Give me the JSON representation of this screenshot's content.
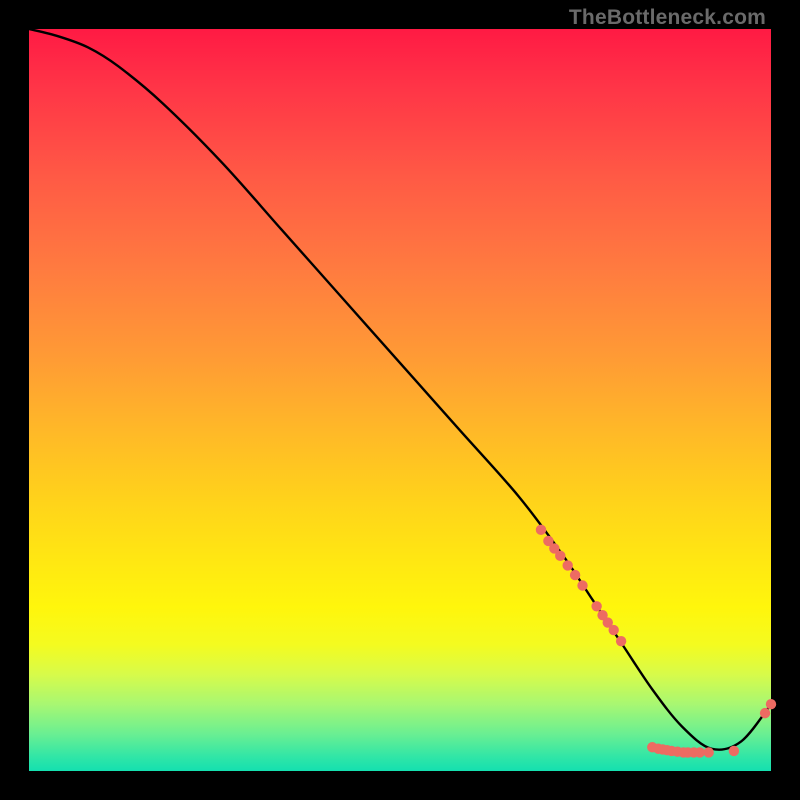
{
  "watermark": "TheBottleneck.com",
  "chart_data": {
    "type": "line",
    "title": "",
    "xlabel": "",
    "ylabel": "",
    "xlim": [
      0,
      100
    ],
    "ylim": [
      0,
      100
    ],
    "grid": false,
    "legend": "none",
    "series": [
      {
        "name": "bottleneck-curve",
        "x": [
          0,
          4,
          8,
          12,
          18,
          26,
          34,
          42,
          50,
          58,
          66,
          72,
          76,
          80,
          84,
          88,
          92,
          96,
          100
        ],
        "y": [
          100,
          99,
          97.5,
          95,
          90,
          82,
          73,
          64,
          55,
          46,
          37,
          29,
          23,
          17,
          11,
          6,
          3,
          4,
          9
        ]
      }
    ],
    "markers": [
      {
        "name": "cluster-upper",
        "points": [
          {
            "x": 69.0,
            "y": 32.5
          },
          {
            "x": 70.0,
            "y": 31.0
          },
          {
            "x": 70.8,
            "y": 30.0
          },
          {
            "x": 71.6,
            "y": 29.0
          },
          {
            "x": 72.6,
            "y": 27.7
          },
          {
            "x": 73.6,
            "y": 26.4
          },
          {
            "x": 74.6,
            "y": 25.0
          }
        ]
      },
      {
        "name": "cluster-mid",
        "points": [
          {
            "x": 76.5,
            "y": 22.2
          },
          {
            "x": 77.3,
            "y": 21.0
          },
          {
            "x": 78.0,
            "y": 20.0
          },
          {
            "x": 78.8,
            "y": 19.0
          },
          {
            "x": 79.8,
            "y": 17.5
          }
        ]
      },
      {
        "name": "cluster-bottom",
        "points": [
          {
            "x": 84.0,
            "y": 3.2
          },
          {
            "x": 84.8,
            "y": 3.0
          },
          {
            "x": 85.4,
            "y": 2.9
          },
          {
            "x": 86.0,
            "y": 2.8
          },
          {
            "x": 86.6,
            "y": 2.7
          },
          {
            "x": 87.4,
            "y": 2.6
          },
          {
            "x": 88.2,
            "y": 2.5
          },
          {
            "x": 88.8,
            "y": 2.5
          },
          {
            "x": 89.6,
            "y": 2.5
          },
          {
            "x": 90.4,
            "y": 2.5
          },
          {
            "x": 91.6,
            "y": 2.5
          },
          {
            "x": 95.0,
            "y": 2.7
          }
        ]
      },
      {
        "name": "cluster-tail",
        "points": [
          {
            "x": 99.2,
            "y": 7.8
          },
          {
            "x": 100.0,
            "y": 9.0
          }
        ]
      }
    ],
    "gradient_stops": [
      {
        "pos": 0,
        "color": "#ff1a44"
      },
      {
        "pos": 50,
        "color": "#ffb022"
      },
      {
        "pos": 78,
        "color": "#fff60c"
      },
      {
        "pos": 100,
        "color": "#14e0b0"
      }
    ]
  }
}
